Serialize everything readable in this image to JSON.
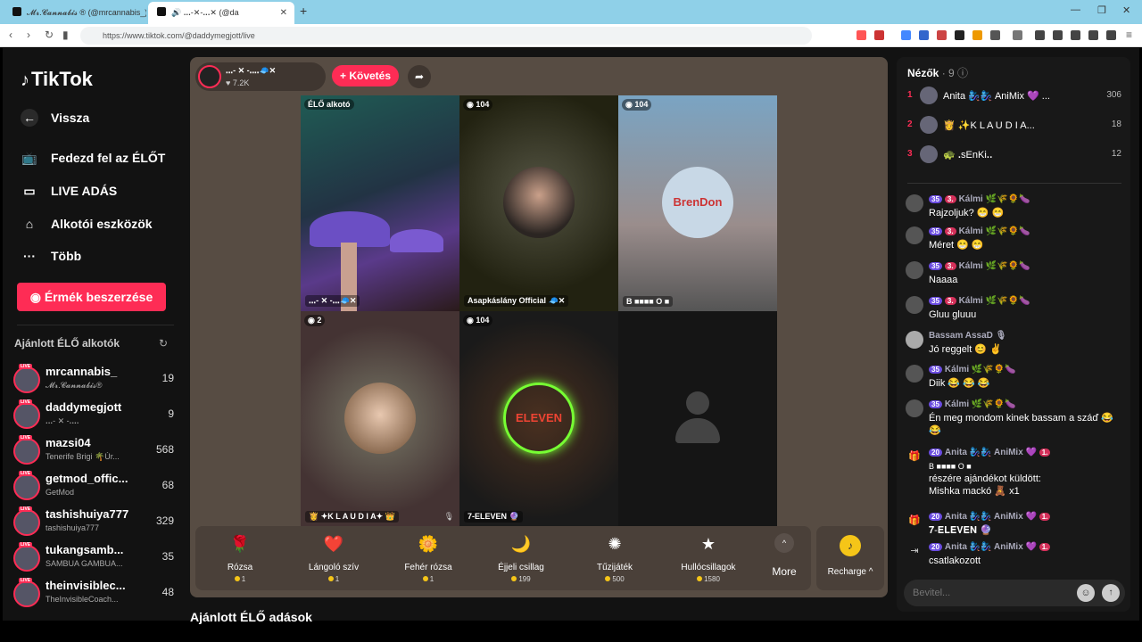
{
  "browser": {
    "tabs": [
      {
        "title": "𝓜𝓻.𝓒𝓪𝓷𝓷𝓪𝓫𝓲𝓼 ® (@mrcannabis_)"
      },
      {
        "title": "🔊 ꓸꓸꓸ-✕-ꓸꓸꓸ✕ (@da"
      }
    ],
    "url": "https://www.tiktok.com/@daddymegjott/live"
  },
  "sidebar": {
    "logo": "TikTok",
    "back": "Vissza",
    "nav": [
      {
        "label": "Fedezd fel az ÉLŐT",
        "icon": "tv-icon"
      },
      {
        "label": "LIVE ADÁS",
        "icon": "camera-icon"
      },
      {
        "label": "Alkotói eszközök",
        "icon": "creator-tools-icon"
      },
      {
        "label": "Több",
        "icon": "more-icon"
      }
    ],
    "coin_button": "Érmék beszerzése",
    "recommended_title": "Ajánlott ÉLŐ alkotók",
    "creators": [
      {
        "name": "mrcannabis_",
        "sub": "𝓜𝓻.𝓒𝓪𝓷𝓷𝓪𝓫𝓲𝓼®",
        "count": "19"
      },
      {
        "name": "daddymegjott",
        "sub": "ꓸꓸꓸ- ✕ -ꓸꓸꓸꓸ",
        "count": "9"
      },
      {
        "name": "mazsi04",
        "sub": "Tenerife Brigi 🌴Úr...",
        "count": "568"
      },
      {
        "name": "getmod_offic...",
        "sub": "GetMod",
        "count": "68"
      },
      {
        "name": "tashishuiya777",
        "sub": "tashishuiya777",
        "count": "329"
      },
      {
        "name": "tukangsamb...",
        "sub": "SAMBUA GAMBUA...",
        "count": "35"
      },
      {
        "name": "theinvisiblec...",
        "sub": "TheInvisibleCoach...",
        "count": "48"
      }
    ],
    "live_tag": "LIVE"
  },
  "stream": {
    "host_name": "ꓸꓸꓸ- ✕ -ꓸꓸꓸꓸ🧢✕",
    "host_likes": "♥ 7.2K",
    "follow": "+ Követés",
    "tiles": [
      {
        "badge": "ÉLŐ alkotó",
        "label": "ꓸꓸꓸ- ✕ -ꓸꓸꓸ🧢✕"
      },
      {
        "badge": "◉ 104",
        "label": "Asapkáslány Official 🧢✕"
      },
      {
        "badge": "◉ 104",
        "label": "B ■■■■ O ■",
        "logo": "BrenDon"
      },
      {
        "badge": "◉ 2",
        "label": "👸 ✦K L A U D I A✦ 👑"
      },
      {
        "badge": "◉ 104",
        "label": "7-ELEVEN 🔮",
        "logo": "ELEVEN"
      },
      {
        "badge": "",
        "label": ""
      }
    ],
    "gifts": [
      {
        "name": "Rózsa",
        "price": "1",
        "icon": "🌹"
      },
      {
        "name": "Lángoló szív",
        "price": "1",
        "icon": "❤️"
      },
      {
        "name": "Fehér rózsa",
        "price": "1",
        "icon": "🌼"
      },
      {
        "name": "Éjjeli csillag",
        "price": "199",
        "icon": "🌙"
      },
      {
        "name": "Tűzijáték",
        "price": "500",
        "icon": "✺"
      },
      {
        "name": "Hullócsillagok",
        "price": "1580",
        "icon": "★"
      }
    ],
    "more": "More",
    "recharge": "Recharge ^",
    "bottom_title": "Ajánlott ÉLŐ adások"
  },
  "viewers": {
    "title": "Nézők",
    "count": "· 9",
    "top": [
      {
        "rank": "1",
        "name": "Anita 🧞‍♀️🧞‍♀️ AniMix 💜 ...",
        "score": "306"
      },
      {
        "rank": "2",
        "name": "👸 ✨K L A U D I A...",
        "score": "18"
      },
      {
        "rank": "3",
        "name": "🐢 ꓸsEnKiꓸꓸ",
        "score": "12"
      }
    ]
  },
  "chat": [
    {
      "user": "Kálmi 🌿🌾🌻🍆",
      "level": "35",
      "fan": "3.",
      "text": "Rajzoljuk? 😁 😁"
    },
    {
      "user": "Kálmi 🌿🌾🌻🍆",
      "level": "35",
      "fan": "3.",
      "text": "Méret 😁 😁"
    },
    {
      "user": "Kálmi 🌿🌾🌻🍆",
      "level": "35",
      "fan": "3.",
      "text": "Naaaa"
    },
    {
      "user": "Kálmi 🌿🌾🌻🍆",
      "level": "35",
      "fan": "3.",
      "text": "Gluu gluuu"
    },
    {
      "user": "Bassam AssaD 🎙",
      "level": "",
      "fan": "",
      "text": "Jó reggelt 😊 ✌"
    },
    {
      "user": "Kálmi 🌿🌾🌻🍆",
      "level": "35",
      "fan": "",
      "text": "Diik 😂 😂 😂"
    },
    {
      "user": "Kálmi 🌿🌾🌻🍆",
      "level": "35",
      "fan": "",
      "text": "Én meg mondom kinek bassam a száď 😂 😂"
    }
  ],
  "gift_msg": {
    "user": "Anita 🧞‍♀️🧞‍♀️ AniMix 💜",
    "level": "20",
    "fan": "1.",
    "line1": "B ■■■■ O ■",
    "line2": "részére ajándékot küldött:",
    "line3": "Mishka mackó 🧸 x1"
  },
  "join_msgs": [
    {
      "user": "Anita 🧞‍♀️🧞‍♀️ AniMix 💜",
      "level": "20",
      "fan": "1.",
      "text": "𝟕-𝐄𝐋𝐄𝐕𝐄𝐍 🔮"
    },
    {
      "user": "Anita 🧞‍♀️🧞‍♀️ AniMix 💜",
      "level": "20",
      "fan": "1.",
      "text": "csatlakozott"
    }
  ],
  "input": {
    "placeholder": "Bevitel..."
  },
  "colors": {
    "accent": "#fe2c55",
    "panel": "#574c43",
    "level": "#6a4ce0"
  }
}
